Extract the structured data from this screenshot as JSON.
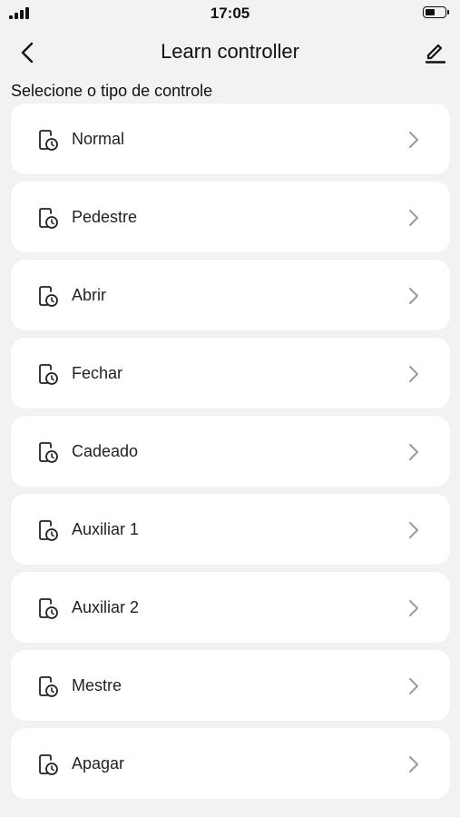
{
  "status_bar": {
    "time": "17:05",
    "battery_level": 0.55
  },
  "nav": {
    "title": "Learn controller",
    "back_icon": "chevron-left-icon",
    "edit_icon": "pencil-icon"
  },
  "section": {
    "header": "Selecione o tipo de controle"
  },
  "items": [
    {
      "label": "Normal",
      "icon": "remote-clock-icon"
    },
    {
      "label": "Pedestre",
      "icon": "remote-clock-icon"
    },
    {
      "label": "Abrir",
      "icon": "remote-clock-icon"
    },
    {
      "label": "Fechar",
      "icon": "remote-clock-icon"
    },
    {
      "label": "Cadeado",
      "icon": "remote-clock-icon"
    },
    {
      "label": "Auxiliar 1",
      "icon": "remote-clock-icon"
    },
    {
      "label": "Auxiliar 2",
      "icon": "remote-clock-icon"
    },
    {
      "label": "Mestre",
      "icon": "remote-clock-icon"
    },
    {
      "label": "Apagar",
      "icon": "remote-clock-icon"
    }
  ],
  "colors": {
    "background": "#f2f2f5",
    "card": "#ffffff",
    "text": "#1c1c1e",
    "chevron": "#9a9a9f"
  }
}
